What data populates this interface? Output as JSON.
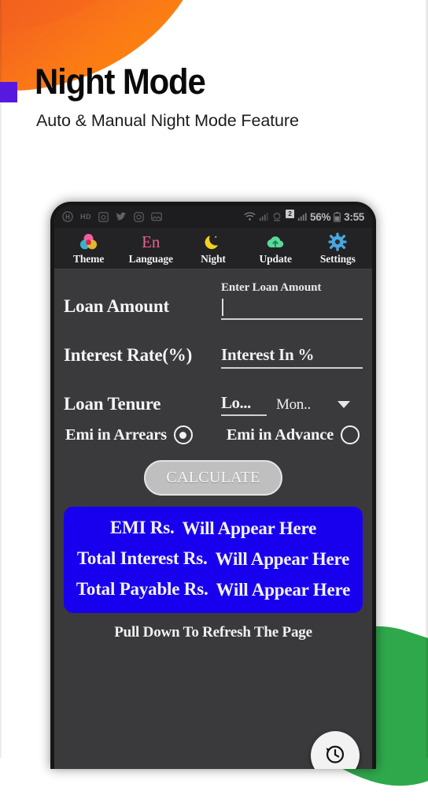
{
  "hero": {
    "title": "Night Mode",
    "subtitle": "Auto & Manual Night Mode Feature",
    "bullet_color": "#5719e0"
  },
  "decor": {
    "orange_blob_color": "#f05a22",
    "green_blob_color": "#2fa84c"
  },
  "phone": {
    "statusbar": {
      "left_icons": [
        "hotspot-icon",
        "hd-icon",
        "screenshot-icon",
        "twitter-icon",
        "instagram-icon",
        "gallery-icon"
      ],
      "hd_label": "HD",
      "sim_badge": "2",
      "battery_percent": "56%",
      "time": "3:55"
    },
    "toolbar": [
      {
        "label": "Theme",
        "icon": "theme-palette-icon"
      },
      {
        "label": "Language",
        "icon": "language-en-icon",
        "glyph": "En"
      },
      {
        "label": "Night",
        "icon": "moon-icon"
      },
      {
        "label": "Update",
        "icon": "cloud-upload-icon"
      },
      {
        "label": "Settings",
        "icon": "gear-icon"
      }
    ],
    "form": {
      "loan_amount": {
        "label": "Loan Amount",
        "caption": "Enter Loan Amount",
        "value": ""
      },
      "interest_rate": {
        "label": "Interest Rate(%)",
        "placeholder": "Interest In %",
        "value": ""
      },
      "loan_tenure": {
        "label": "Loan Tenure",
        "value": "Lo...",
        "unit": "Mon..",
        "dropdown_icon": "chevron-down-icon"
      },
      "emi_type": {
        "arrears_label": "Emi in Arrears",
        "advance_label": "Emi in Advance",
        "selected": "arrears"
      },
      "calculate_label": "CALCULATE"
    },
    "results": {
      "background_color": "#1800ef",
      "rows": [
        {
          "key": "EMI Rs.",
          "value": "Will Appear Here"
        },
        {
          "key": "Total Interest Rs.",
          "value": "Will Appear Here"
        },
        {
          "key": "Total Payable Rs.",
          "value": "Will Appear Here"
        }
      ]
    },
    "pull_hint": "Pull Down To Refresh The Page",
    "fab": {
      "icon": "history-clock-icon"
    }
  }
}
